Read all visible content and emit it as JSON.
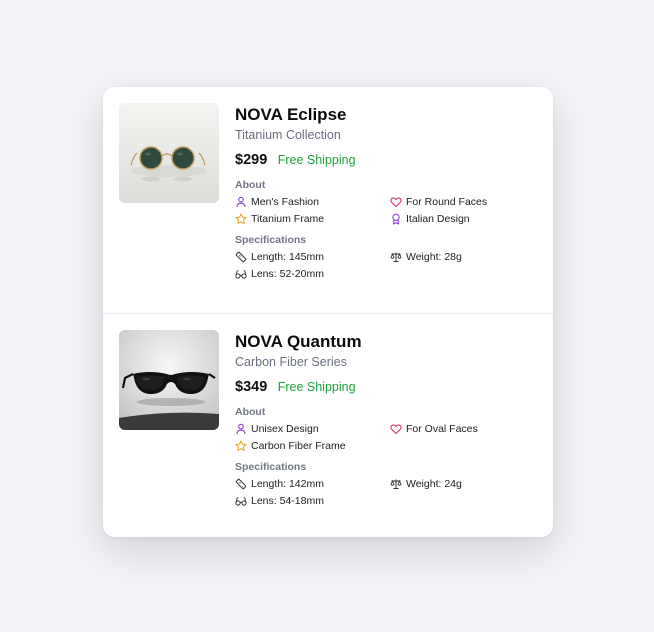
{
  "products": [
    {
      "name": "NOVA Eclipse",
      "collection": "Titanium Collection",
      "price": "$299",
      "shipping": "Free Shipping",
      "about_label": "About",
      "about": [
        {
          "icon": "person-icon",
          "text": "Men's Fashion"
        },
        {
          "icon": "heart-icon",
          "text": "For Round Faces"
        },
        {
          "icon": "star-icon",
          "text": "Titanium Frame"
        },
        {
          "icon": "award-icon",
          "text": "Italian Design"
        }
      ],
      "spec_label": "Specifications",
      "specs": [
        {
          "icon": "ruler-icon",
          "text": "Length: 145mm"
        },
        {
          "icon": "scale-icon",
          "text": "Weight: 28g"
        },
        {
          "icon": "glasses-icon",
          "text": "Lens: 52-20mm"
        }
      ]
    },
    {
      "name": "NOVA Quantum",
      "collection": "Carbon Fiber Series",
      "price": "$349",
      "shipping": "Free Shipping",
      "about_label": "About",
      "about": [
        {
          "icon": "person-icon",
          "text": "Unisex Design"
        },
        {
          "icon": "heart-icon",
          "text": "For Oval Faces"
        },
        {
          "icon": "star-icon",
          "text": "Carbon Fiber Frame"
        }
      ],
      "spec_label": "Specifications",
      "specs": [
        {
          "icon": "ruler-icon",
          "text": "Length: 142mm"
        },
        {
          "icon": "scale-icon",
          "text": "Weight: 24g"
        },
        {
          "icon": "glasses-icon",
          "text": "Lens: 54-18mm"
        }
      ]
    }
  ],
  "colors": {
    "shipping": "#1ea33a",
    "person_icon": "#8b3fd9",
    "heart_icon": "#e0355e",
    "star_icon": "#e6a21b",
    "award_icon": "#8b3fd9",
    "spec_icon": "#333333"
  }
}
